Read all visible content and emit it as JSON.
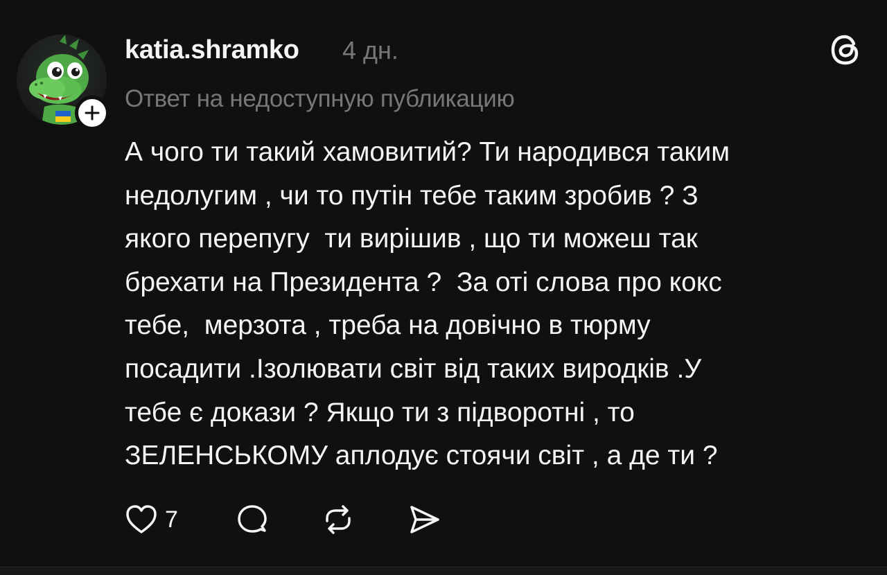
{
  "post": {
    "username": "katia.shramko",
    "time_ago": "4 дн.",
    "reply_context": "Ответ на недоступную публикацию",
    "body": "А чого ти такий хамовитий? Ти народився таким\nнедолугим , чи то путін тебе таким зробив ? З\nякого перепугу  ти вирішив , що ти можеш так\nбрехати на Президента ?  За оті слова про кокс\nтебе,  мерзота , треба на довічно в тюрму\nпосадити .Ізолювати світ від таких виродків .У\nтебе є докази ? Якщо ти з підворотні , то\nЗЕЛЕНСЬКОМУ аплодує стоячи світ , а де ти ?",
    "like_count": "7"
  },
  "icons": {
    "logo": "threads-logo-icon",
    "follow": "plus-icon",
    "like": "heart-icon",
    "comment": "comment-bubble-icon",
    "repost": "repost-icon",
    "share": "send-icon"
  },
  "colors": {
    "background": "#101010",
    "primary_text": "#f3f5f7",
    "secondary_text": "#777777",
    "badge_bg": "#ffffff"
  }
}
